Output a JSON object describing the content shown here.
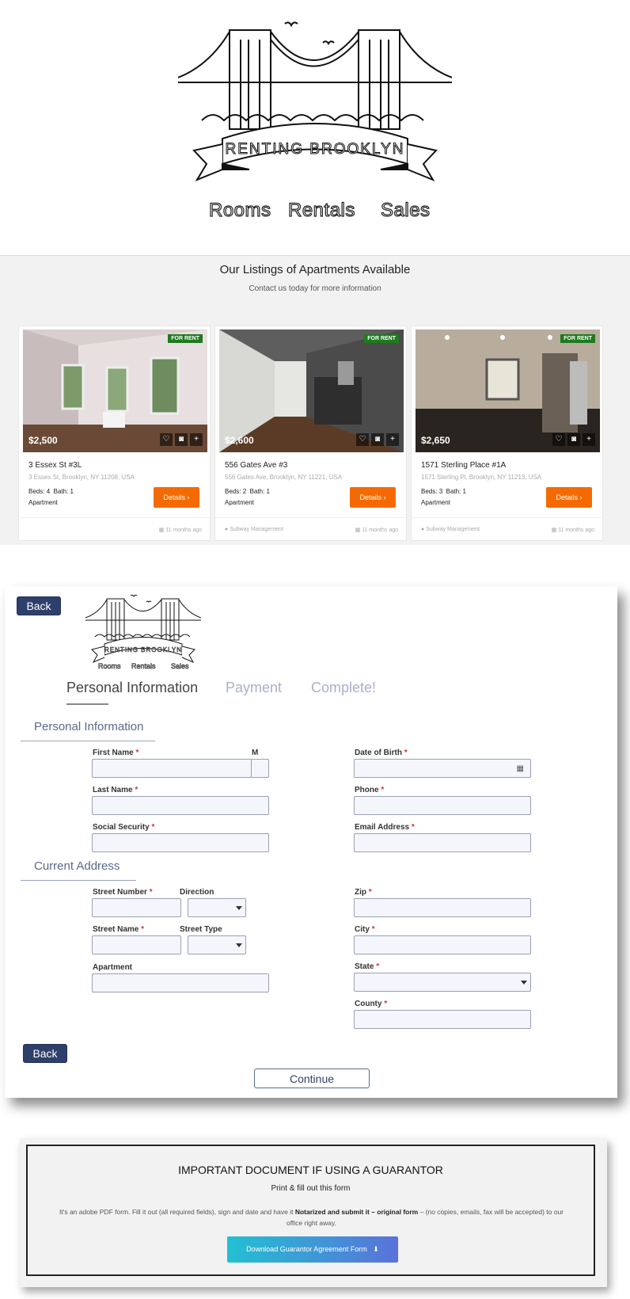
{
  "header": {
    "logo_text": "RENTING BROOKLYN",
    "nav": [
      "Rooms",
      "Rentals",
      "Sales"
    ]
  },
  "listings": {
    "title": "Our Listings of Apartments Available",
    "subtitle": "Contact us today for more information",
    "cards": [
      {
        "badge": "FOR RENT",
        "price": "$2,500",
        "address": "3 Essex St #3L",
        "full_address": "3 Essex St, Brooklyn, NY 11208, USA",
        "beds_label": "Beds:",
        "beds": "4",
        "bath_label": "Bath:",
        "bath": "1",
        "type": "Apartment",
        "details": "Details",
        "agent": "",
        "posted": "11 months ago"
      },
      {
        "badge": "FOR RENT",
        "price": "$2,600",
        "address": "556 Gates Ave #3",
        "full_address": "556 Gates Ave, Brooklyn, NY 11221, USA",
        "beds_label": "Beds:",
        "beds": "2",
        "bath_label": "Bath:",
        "bath": "1",
        "type": "Apartment",
        "details": "Details",
        "agent": "Subway Management",
        "posted": "11 months ago"
      },
      {
        "badge": "FOR RENT",
        "price": "$2,650",
        "address": "1571 Sterling Place #1A",
        "full_address": "1571 Sterling Pl, Brooklyn, NY 11213, USA",
        "beds_label": "Beds:",
        "beds": "3",
        "bath_label": "Bath:",
        "bath": "1",
        "type": "Apartment",
        "details": "Details",
        "agent": "Subway Management",
        "posted": "11 months ago"
      }
    ]
  },
  "form": {
    "back_label": "Back",
    "logo_nav": [
      "Rooms",
      "Rentals",
      "Sales"
    ],
    "steps": [
      "Personal Information",
      "Payment",
      "Complete!"
    ],
    "section_personal": "Personal Information",
    "section_address": "Current Address",
    "labels": {
      "first_name": "First Name",
      "middle": "M",
      "last_name": "Last Name",
      "ssn": "Social Security",
      "dob": "Date of Birth",
      "phone": "Phone",
      "email": "Email Address",
      "street_number": "Street Number",
      "direction": "Direction",
      "street_name": "Street Name",
      "street_type": "Street Type",
      "apartment": "Apartment",
      "zip": "Zip",
      "city": "City",
      "state": "State",
      "county": "County"
    },
    "required_mark": "*",
    "continue_label": "Continue"
  },
  "guarantor": {
    "title": "IMPORTANT DOCUMENT IF USING A GUARANTOR",
    "print": "Print & fill out this form",
    "text_a": "It's an adobe PDF form. Fill it out (all required fields), sign and date and have it ",
    "text_b": "Notarized and submit it – original form",
    "text_c": " – (no copies, emails, fax will be accepted) to our office right away.",
    "button": "Download Guarantor Agreement Form"
  },
  "colors": {
    "accent_orange": "#f56a00",
    "navy": "#2f3f6b",
    "badge_green": "#1f7a1f"
  }
}
